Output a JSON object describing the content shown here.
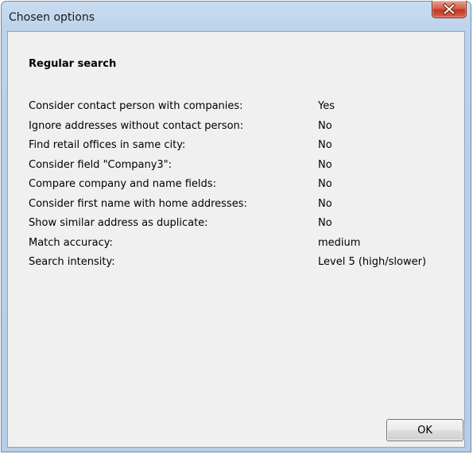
{
  "window": {
    "title": "Chosen options",
    "close_icon": "close-x-icon"
  },
  "section": {
    "heading": "Regular search"
  },
  "options": [
    {
      "label": "Consider contact person with companies:",
      "value": "Yes"
    },
    {
      "label": "Ignore addresses without contact person:",
      "value": "No"
    },
    {
      "label": "Find retail offices in same city:",
      "value": "No"
    },
    {
      "label": "Consider field \"Company3\":",
      "value": "No"
    },
    {
      "label": "Compare company and name fields:",
      "value": "No"
    },
    {
      "label": "Consider first name with home addresses:",
      "value": "No"
    },
    {
      "label": "Show similar address as duplicate:",
      "value": "No"
    },
    {
      "label": "Match accuracy:",
      "value": "medium"
    },
    {
      "label": "Search intensity:",
      "value": "Level 5 (high/slower)"
    }
  ],
  "buttons": {
    "ok_label": "OK"
  },
  "colors": {
    "frame": "#bcd2ea",
    "client_background": "#f0f0f0",
    "close_button": "#c3361f"
  }
}
